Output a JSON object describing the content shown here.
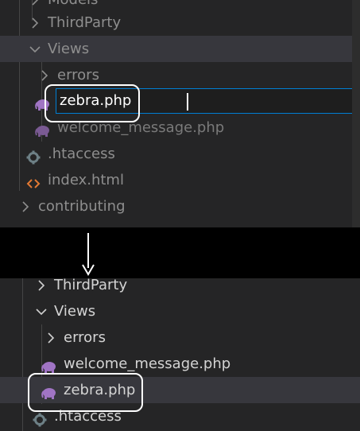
{
  "top": {
    "rows": [
      {
        "label": "Models"
      },
      {
        "label": "ThirdParty"
      },
      {
        "label": "Views"
      },
      {
        "label": "errors"
      },
      {
        "label": "zebra.php"
      },
      {
        "label": "welcome_message.php"
      },
      {
        "label": ".htaccess"
      },
      {
        "label": "index.html"
      },
      {
        "label": "contributing"
      }
    ],
    "rename_value": "zebra.php"
  },
  "bottom": {
    "rows": [
      {
        "label": "ThirdParty"
      },
      {
        "label": "Views"
      },
      {
        "label": "errors"
      },
      {
        "label": "welcome_message.php"
      },
      {
        "label": "zebra.php"
      },
      {
        "label": ".htaccess"
      }
    ]
  },
  "icons": {
    "php": "php-elephant-icon",
    "gear": "gear-icon",
    "html": "html-brackets-icon",
    "chevron_right": "chevron-right-icon",
    "chevron_down": "chevron-down-icon",
    "arrow": "down-arrow-icon"
  },
  "colors": {
    "panel_bg": "#252526",
    "selected_row": "#37373d",
    "focus_border": "#007fd4",
    "php_icon": "#a074c4",
    "gear_icon": "#6d8086",
    "html_icon": "#e37933",
    "callout": "#ffffff"
  }
}
